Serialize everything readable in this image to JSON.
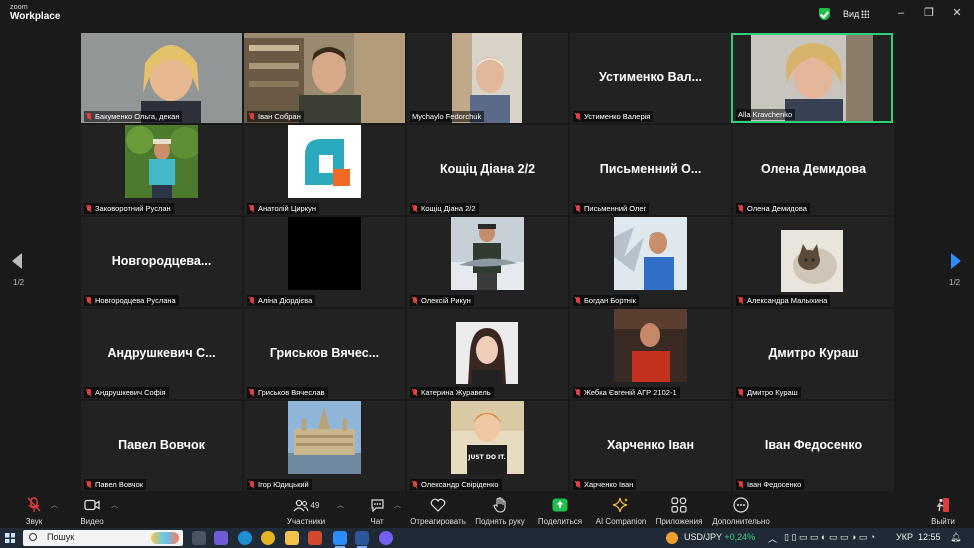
{
  "app": {
    "brand_small": "zoom",
    "brand_big": "Workplace",
    "view_label": "Вид"
  },
  "colors": {
    "active_speaker_border": "#2fd07a",
    "muted_mic": "#e04040",
    "share_button": "#1fbf4c",
    "leave_button": "#e03c3c",
    "next_page_arrow": "#2d8cff"
  },
  "pagination": {
    "left": "1/2",
    "right": "1/2"
  },
  "participants": [
    {
      "label": "Бакуменко Ольга, декан",
      "display": "",
      "video": "photo-woman-blonde"
    },
    {
      "label": "Іван Собран",
      "display": "",
      "video": "photo-man-bookshelf"
    },
    {
      "label": "Mychaylo Fedorchuk",
      "display": "",
      "video": "photo-elderly-man"
    },
    {
      "label": "Устименко Валерія",
      "display": "Устименко Вал...",
      "video": ""
    },
    {
      "label": "Alla Kravchenko",
      "display": "",
      "video": "photo-woman-speaking",
      "active": true
    },
    {
      "label": "Заковоротний Руслан",
      "display": "",
      "video": "photo-man-field"
    },
    {
      "label": "Анатолій Циркун",
      "display": "",
      "video": "logo-avatar"
    },
    {
      "label": "Кощіц Діана 2/2",
      "display": "Кощіц Діана 2/2",
      "video": ""
    },
    {
      "label": "Письменний Олег",
      "display": "Письменний О...",
      "video": ""
    },
    {
      "label": "Олена Демидова",
      "display": "Олена Демидова",
      "video": ""
    },
    {
      "label": "Новгородцева Руслана",
      "display": "Новгородцева...",
      "video": ""
    },
    {
      "label": "Аліна Діордієва",
      "display": "",
      "video": "black-square"
    },
    {
      "label": "Олексій Рикун",
      "display": "",
      "video": "photo-man-fish"
    },
    {
      "label": "Богдан Бортнік",
      "display": "",
      "video": "photo-man-fountain"
    },
    {
      "label": "Александра Малыхина",
      "display": "",
      "video": "photo-cat"
    },
    {
      "label": "Андрушкевич Софія",
      "display": "Андрушкевич С...",
      "video": ""
    },
    {
      "label": "Гриськов Вячеслав",
      "display": "Гриськов Вячес...",
      "video": ""
    },
    {
      "label": "Катерина Журавель",
      "display": "",
      "video": "photo-girl"
    },
    {
      "label": "Жебка Євгеній АГР 2102-1",
      "display": "",
      "video": "photo-man-red"
    },
    {
      "label": "Дмитро Кураш",
      "display": "Дмитро Кураш",
      "video": ""
    },
    {
      "label": "Павел Вовчок",
      "display": "Павел Вовчок",
      "video": ""
    },
    {
      "label": "Ігор Юдицький",
      "display": "",
      "video": "photo-parliament"
    },
    {
      "label": "Олександр Свіріденко",
      "display": "",
      "video": "avatar-boy-justdoit"
    },
    {
      "label": "Харченко Іван",
      "display": "Харченко Іван",
      "video": ""
    },
    {
      "label": "Іван Федосенко",
      "display": "Іван Федосенко",
      "video": ""
    }
  ],
  "toolbar": {
    "audio": "Звук",
    "video": "Видео",
    "participants": "Участники",
    "participants_count": "49",
    "chat": "Чат",
    "react": "Отреагировать",
    "raise_hand": "Поднять руку",
    "share": "Поделиться",
    "ai": "AI Companion",
    "apps": "Приложения",
    "more": "Дополнительно",
    "leave": "Выйти"
  },
  "taskbar": {
    "search": "Пошук",
    "currency": "USD/JPY",
    "change": "+0,24%",
    "lang": "УКР",
    "time": "12:55"
  }
}
